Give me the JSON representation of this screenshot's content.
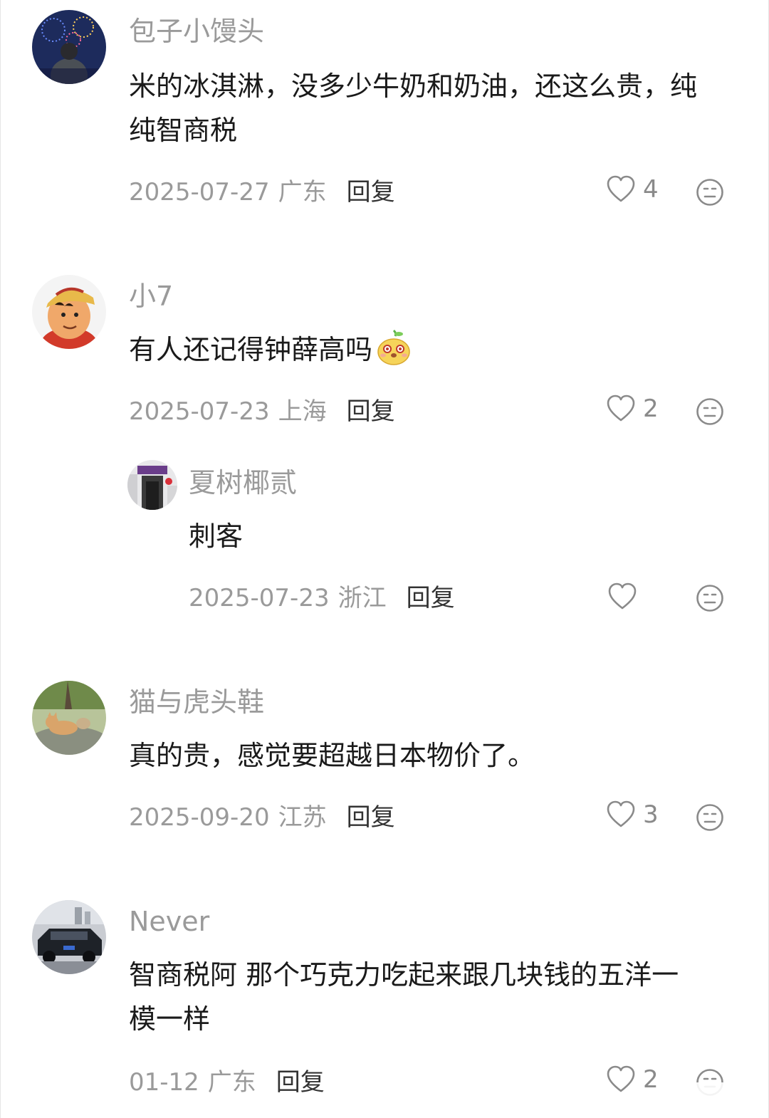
{
  "comments": [
    {
      "username": "包子小馒头",
      "lines": [
        "米的冰淇淋，没多少牛奶和奶油，还这么贵，纯",
        "纯智商税"
      ],
      "date": "2025-07-27",
      "region": "广东",
      "reply_label": "回复",
      "likes": "4"
    },
    {
      "username": "小7",
      "lines": [
        "有人还记得钟薛高吗"
      ],
      "date": "2025-07-23",
      "region": "上海",
      "reply_label": "回复",
      "likes": "2",
      "reply": {
        "username": "夏树椰贰",
        "lines": [
          "刺客"
        ],
        "date": "2025-07-23",
        "region": "浙江",
        "reply_label": "回复",
        "likes": ""
      }
    },
    {
      "username": "猫与虎头鞋",
      "lines": [
        "真的贵，感觉要超越日本物价了。"
      ],
      "date": "2025-09-20",
      "region": "江苏",
      "reply_label": "回复",
      "likes": "3"
    },
    {
      "username": "Never",
      "lines": [
        "智商税阿 那个巧克力吃起来跟几块钱的五洋一",
        "模一样"
      ],
      "date": "01-12",
      "region": "广东",
      "reply_label": "回复",
      "likes": "2"
    }
  ],
  "icons": {
    "like": "heart-outline-icon",
    "react": "neutral-face-icon",
    "emoji": "pear-face-emoji"
  },
  "colors": {
    "username": "#9a9a9a",
    "text": "#1a1a1a",
    "meta": "#9a9a9a",
    "reply": "#333333"
  }
}
